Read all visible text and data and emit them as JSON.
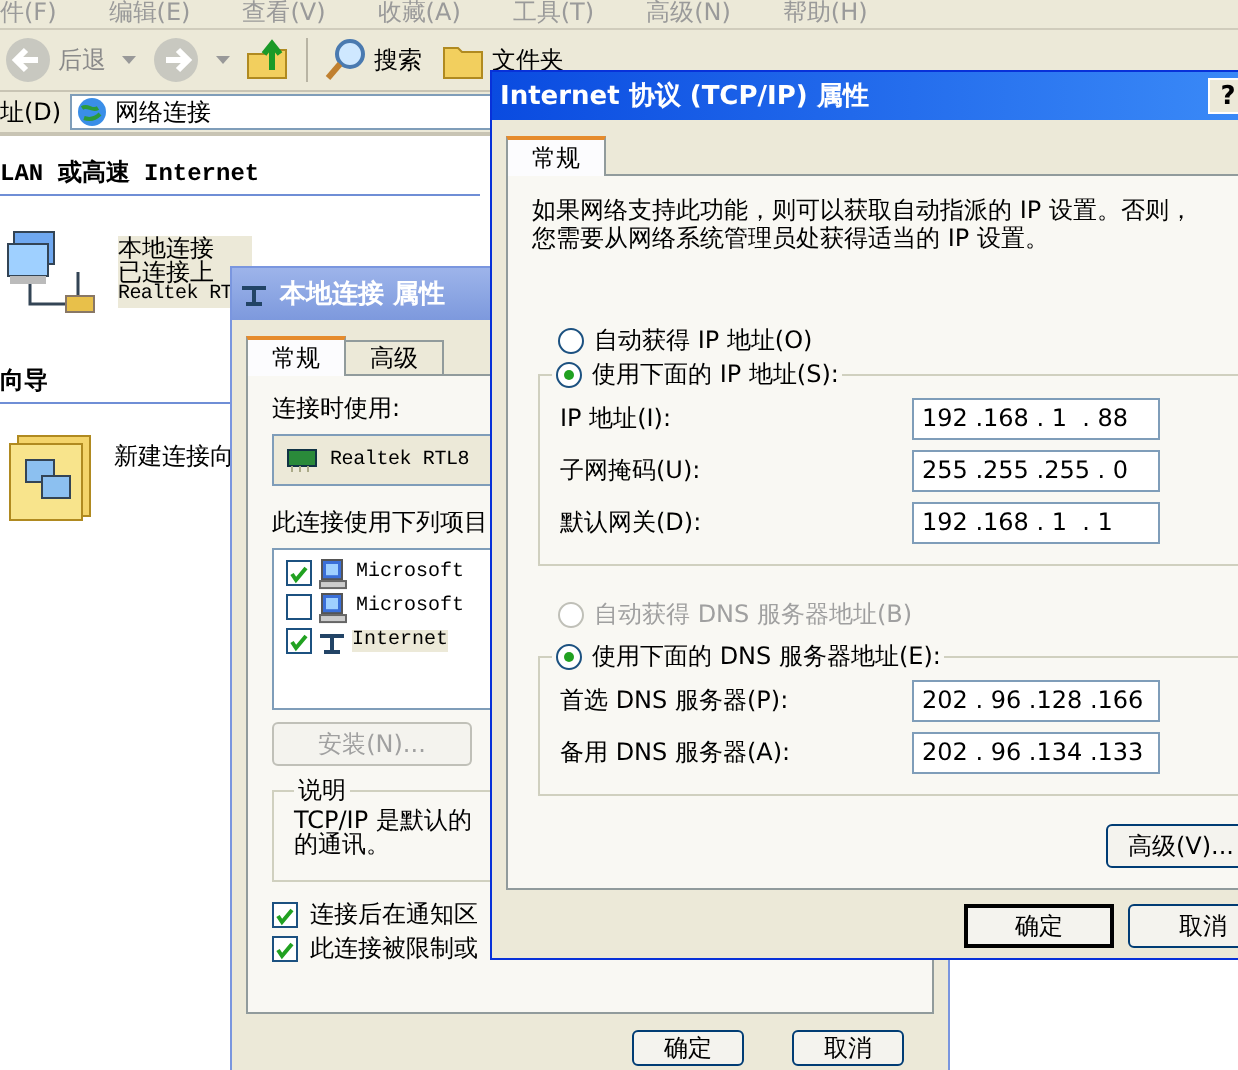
{
  "explorer": {
    "menu": [
      "件(F)",
      "编辑(E)",
      "查看(V)",
      "收藏(A)",
      "工具(T)",
      "高级(N)",
      "帮助(H)"
    ],
    "toolbar": {
      "back": "后退",
      "search": "搜索",
      "folders": "文件夹"
    },
    "address": {
      "label": "址(D)",
      "value": "网络连接"
    },
    "groups": [
      {
        "title": "LAN 或高速 Internet",
        "items": [
          {
            "kind": "lan",
            "selected": true,
            "lines": [
              "本地连接",
              "已连接上",
              "Realtek RT"
            ]
          }
        ]
      },
      {
        "title": "向导",
        "items": [
          {
            "kind": "wizard",
            "selected": false,
            "lines": [
              "新建连接向"
            ]
          }
        ]
      }
    ]
  },
  "lan_dialog": {
    "title": "本地连接 属性",
    "tabs": [
      {
        "label": "常规",
        "selected": true
      },
      {
        "label": "高级",
        "selected": false
      }
    ],
    "connect_using": "连接时使用:",
    "adapter": "Realtek RTL8",
    "items_label": "此连接使用下列项目",
    "components": [
      {
        "kind": "client",
        "label": "Microsoft",
        "checked": true,
        "selected": false
      },
      {
        "kind": "service",
        "label": "Microsoft",
        "checked": false,
        "selected": false
      },
      {
        "kind": "protocol",
        "label": "Internet",
        "checked": true,
        "selected": true
      }
    ],
    "install": {
      "label": "安装(N)...",
      "disabled": true
    },
    "description": {
      "title": "说明",
      "lines": [
        "TCP/IP 是默认的",
        "的通讯。"
      ]
    },
    "options": [
      {
        "label": "连接后在通知区",
        "checked": true
      },
      {
        "label": "此连接被限制或",
        "checked": true
      }
    ],
    "buttons": [
      "确定",
      "取消"
    ]
  },
  "tcpip_dialog": {
    "title": "Internet 协议 (TCP/IP) 属性",
    "help": "?",
    "tabs": [
      {
        "label": "常规",
        "selected": true
      }
    ],
    "intro": "如果网络支持此功能，则可以获取自动指派的 IP 设置。否则，您需要从网络系统管理员处获得适当的 IP 设置。",
    "ip_modes": [
      {
        "label": "自动获得 IP 地址(O)",
        "selected": false,
        "disabled": false
      },
      {
        "label": "使用下面的 IP 地址(S):",
        "selected": true,
        "disabled": false
      }
    ],
    "ip_fields": [
      {
        "label": "IP 地址(I):",
        "value": "192 .168 . 1  . 88"
      },
      {
        "label": "子网掩码(U):",
        "value": "255 .255 .255 . 0"
      },
      {
        "label": "默认网关(D):",
        "value": "192 .168 . 1  . 1"
      }
    ],
    "dns_modes": [
      {
        "label": "自动获得 DNS 服务器地址(B)",
        "selected": false,
        "disabled": true
      },
      {
        "label": "使用下面的 DNS 服务器地址(E):",
        "selected": true,
        "disabled": false
      }
    ],
    "dns_fields": [
      {
        "label": "首选 DNS 服务器(P):",
        "value": "202 . 96 .128 .166"
      },
      {
        "label": "备用 DNS 服务器(A):",
        "value": "202 . 96 .134 .133"
      }
    ],
    "advanced": "高级(V)...",
    "buttons": [
      {
        "label": "确定",
        "default": true
      },
      {
        "label": "取消",
        "default": false
      }
    ]
  }
}
